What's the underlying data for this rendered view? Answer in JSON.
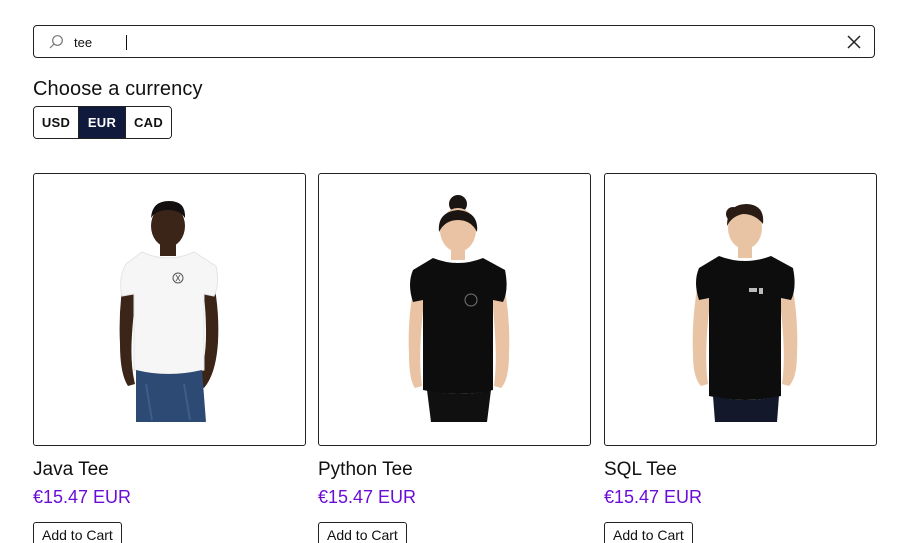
{
  "search": {
    "value": "tee",
    "icon": "search-icon",
    "clear_icon": "close-icon"
  },
  "currency": {
    "title": "Choose a currency",
    "options": [
      "USD",
      "EUR",
      "CAD"
    ],
    "selected": "EUR",
    "active_color": "#0f1a3d"
  },
  "products": [
    {
      "name": "Java Tee",
      "price": "€15.47 EUR",
      "button": "Add to Cart",
      "shirt_color": "white"
    },
    {
      "name": "Python Tee",
      "price": "€15.47 EUR",
      "button": "Add to Cart",
      "shirt_color": "black"
    },
    {
      "name": "SQL Tee",
      "price": "€15.47 EUR",
      "button": "Add to Cart",
      "shirt_color": "black"
    }
  ],
  "colors": {
    "price": "#6a0dd6",
    "border": "#222222"
  }
}
